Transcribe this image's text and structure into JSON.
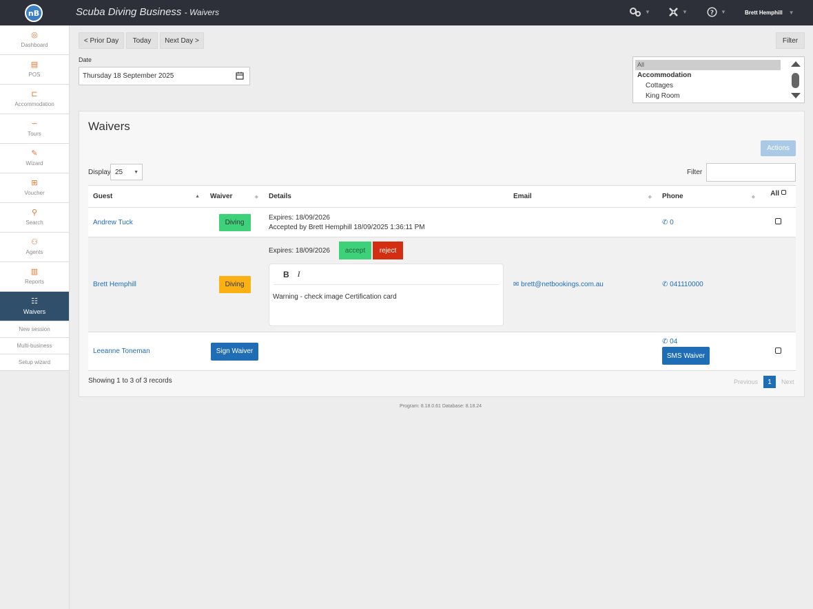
{
  "app": {
    "logo_text": "nB",
    "title": "Scuba Diving Business",
    "page": "Waivers",
    "user_name": "Brett Hemphill"
  },
  "topbar": {
    "icons": [
      "gears-icon",
      "tools-icon",
      "help-icon"
    ]
  },
  "sidebar": {
    "items": [
      {
        "label": "Dashboard",
        "icon": "dashboard-icon"
      },
      {
        "label": "POS",
        "icon": "register-icon"
      },
      {
        "label": "Accommodation",
        "icon": "bed-icon"
      },
      {
        "label": "Tours",
        "icon": "route-icon"
      },
      {
        "label": "Wizard",
        "icon": "magic-wand-icon"
      },
      {
        "label": "Voucher",
        "icon": "gift-icon"
      },
      {
        "label": "Search",
        "icon": "search-icon"
      },
      {
        "label": "Agents",
        "icon": "agents-icon"
      },
      {
        "label": "Reports",
        "icon": "report-icon"
      },
      {
        "label": "Waivers",
        "icon": "checklist-icon",
        "active": true
      }
    ],
    "sub_items": [
      "New session",
      "Multi-business",
      "Setup wizard"
    ]
  },
  "date_nav": {
    "prior": "< Prior Day",
    "today": "Today",
    "next": "Next Day >",
    "filter": "Filter",
    "date_label": "Date",
    "date_value": "Thursday 18 September 2025"
  },
  "filter_list": {
    "items": [
      {
        "label": "All",
        "kind": "selected"
      },
      {
        "label": "Accommodation",
        "kind": "header"
      },
      {
        "label": "Cottages",
        "kind": "child"
      },
      {
        "label": "King Room",
        "kind": "child"
      }
    ]
  },
  "panel": {
    "title": "Waivers",
    "actions": "Actions",
    "display_label": "Display",
    "display_value": "25",
    "filter_label": "Filter",
    "filter_value": ""
  },
  "table": {
    "headers": {
      "guest": "Guest",
      "waiver": "Waiver",
      "details": "Details",
      "email": "Email",
      "phone": "Phone",
      "all": "All"
    },
    "rows": [
      {
        "guest": "Andrew Tuck",
        "waiver": "Diving",
        "details_line1": "Expires: 18/09/2026",
        "details_line2": "Accepted by Brett Hemphill 18/09/2025 1:36:11 PM",
        "email": "",
        "phone": "0"
      },
      {
        "guest": "Brett Hemphill",
        "waiver": "Diving",
        "details_line1": "Expires: 18/09/2026",
        "accept": "accept",
        "reject": "reject",
        "editor_bold": "B",
        "editor_italic": "I",
        "editor_text": "Warning - check image Certification card",
        "email": "brett@netbookings.com.au",
        "phone": "041110000"
      },
      {
        "guest": "Leeanne Toneman",
        "sign": "Sign Waiver",
        "email": "",
        "phone": "04",
        "sms": "SMS Waiver"
      }
    ]
  },
  "pagination": {
    "showing": "Showing 1 to 3 of 3 records",
    "previous": "Previous",
    "page": "1",
    "next": "Next"
  },
  "footer": "Program: 8.18.0.61 Database: 8.18.24",
  "colors": {
    "topbar": "#2d3038",
    "accent": "#1f6db5",
    "active_nav": "#2f4f6b",
    "green": "#3dd27a",
    "orange": "#fbb114",
    "red": "#d42e12"
  }
}
